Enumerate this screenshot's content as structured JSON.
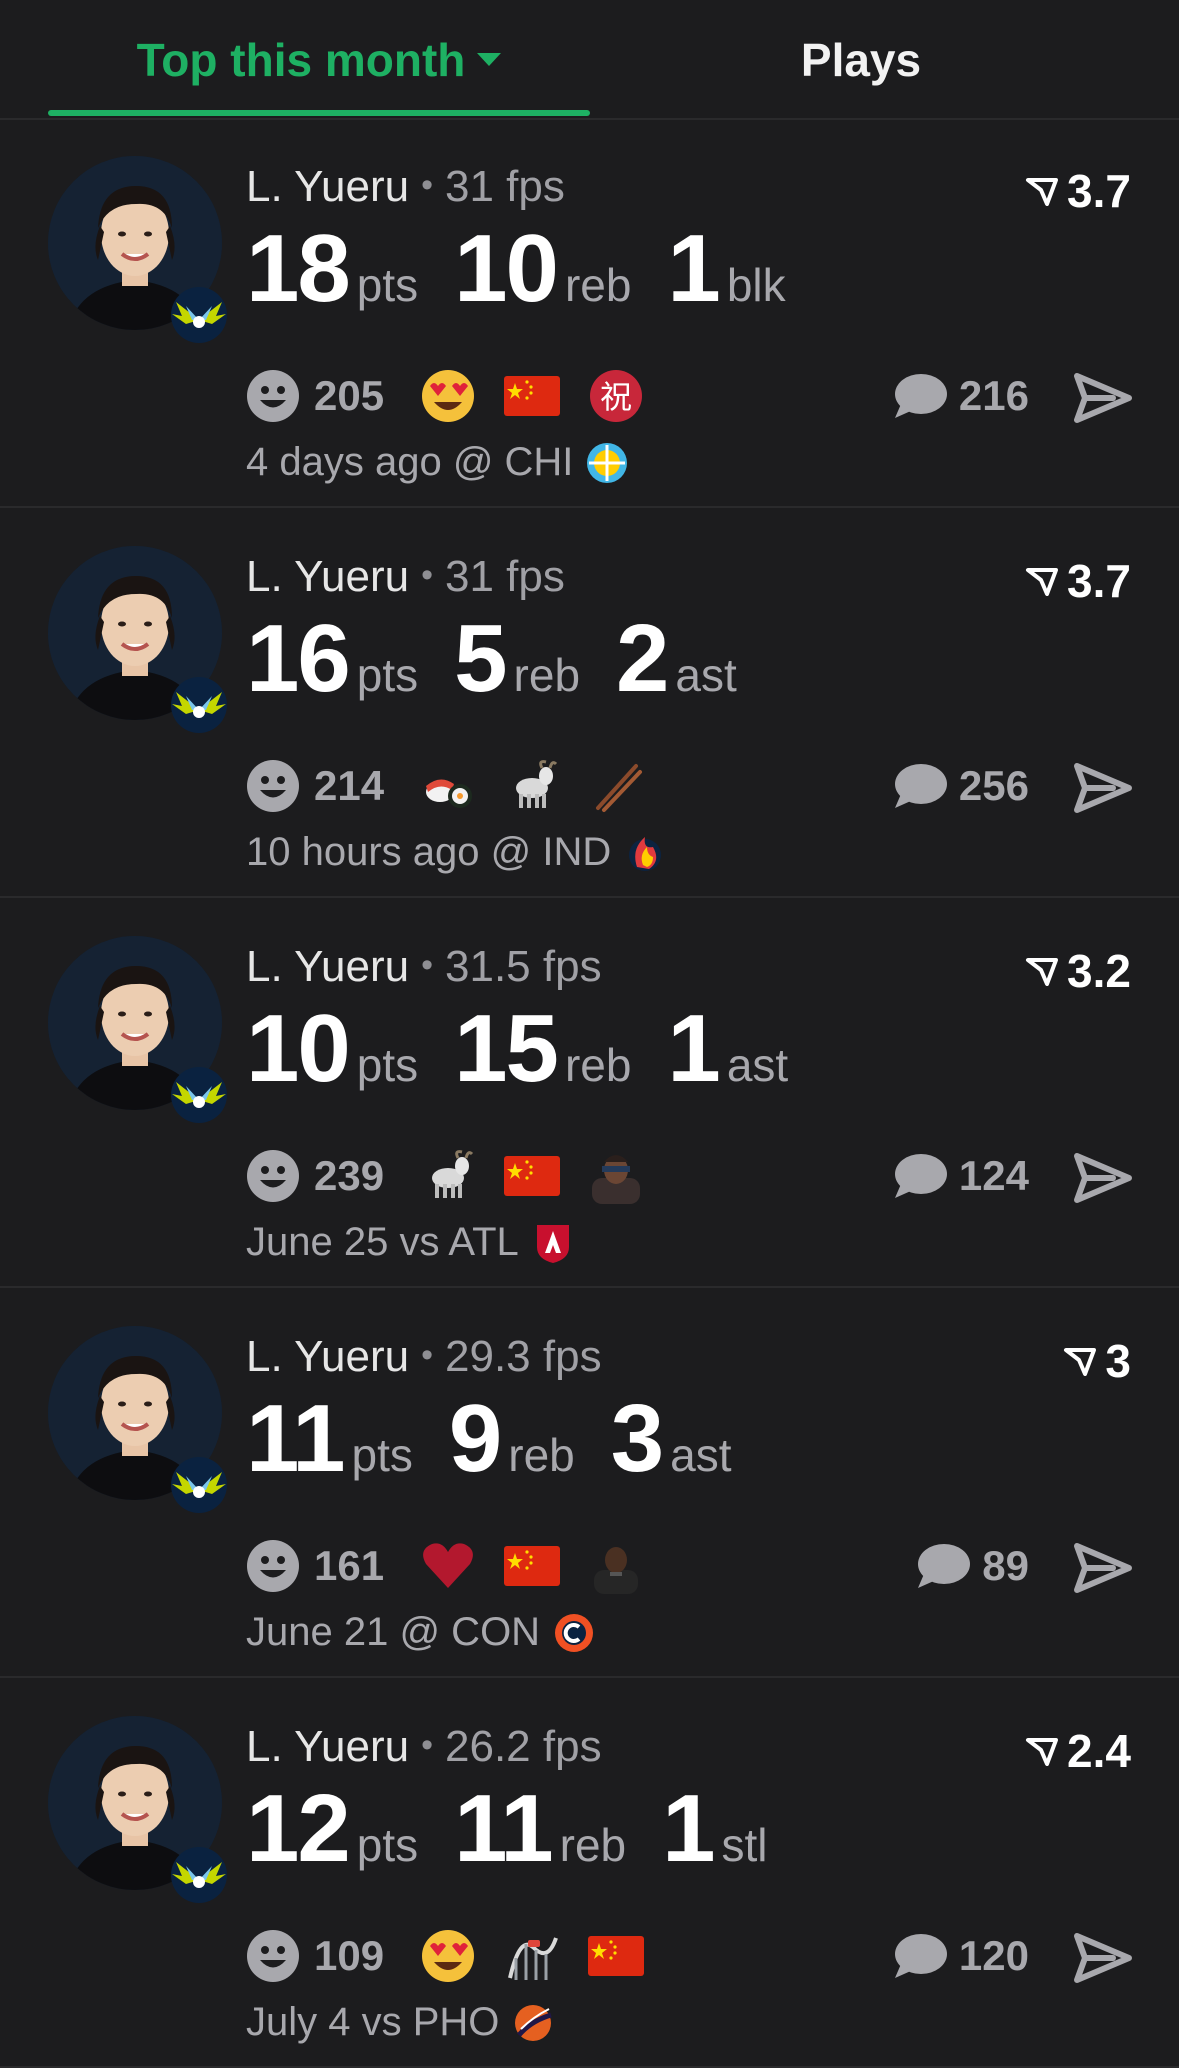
{
  "tabs": {
    "top_label": "Top this month",
    "plays_label": "Plays"
  },
  "colors": {
    "accent": "#1eb063",
    "background": "#1c1c1e",
    "muted": "#a8a8ad"
  },
  "cards": [
    {
      "player": "L. Yueru",
      "fps": "31 fps",
      "rating": "3.7",
      "stats": [
        {
          "num": "18",
          "lbl": "pts"
        },
        {
          "num": "10",
          "lbl": "reb"
        },
        {
          "num": "1",
          "lbl": "blk"
        }
      ],
      "reactions": "205",
      "emojis": [
        "heart-eyes-emoji",
        "china-flag-emoji",
        "congrats-kanji-emoji"
      ],
      "comments": "216",
      "meta": "4 days ago @ CHI",
      "team_logo": "chi-sky-logo"
    },
    {
      "player": "L. Yueru",
      "fps": "31 fps",
      "rating": "3.7",
      "stats": [
        {
          "num": "16",
          "lbl": "pts"
        },
        {
          "num": "5",
          "lbl": "reb"
        },
        {
          "num": "2",
          "lbl": "ast"
        }
      ],
      "reactions": "214",
      "emojis": [
        "sushi-emoji",
        "goat-emoji",
        "chopsticks-emoji"
      ],
      "comments": "256",
      "meta": "10 hours ago @ IND",
      "team_logo": "ind-fever-logo"
    },
    {
      "player": "L. Yueru",
      "fps": "31.5 fps",
      "rating": "3.2",
      "stats": [
        {
          "num": "10",
          "lbl": "pts"
        },
        {
          "num": "15",
          "lbl": "reb"
        },
        {
          "num": "1",
          "lbl": "ast"
        }
      ],
      "reactions": "239",
      "emojis": [
        "goat-emoji",
        "china-flag-emoji",
        "person-blindfold-emoji"
      ],
      "comments": "124",
      "meta": "June 25 vs ATL",
      "team_logo": "atl-dream-logo"
    },
    {
      "player": "L. Yueru",
      "fps": "29.3 fps",
      "rating": "3",
      "stats": [
        {
          "num": "11",
          "lbl": "pts"
        },
        {
          "num": "9",
          "lbl": "reb"
        },
        {
          "num": "3",
          "lbl": "ast"
        }
      ],
      "reactions": "161",
      "emojis": [
        "red-heart-emoji",
        "china-flag-emoji",
        "person-emoji"
      ],
      "comments": "89",
      "meta": "June 21 @ CON",
      "team_logo": "con-sun-logo"
    },
    {
      "player": "L. Yueru",
      "fps": "26.2 fps",
      "rating": "2.4",
      "stats": [
        {
          "num": "12",
          "lbl": "pts"
        },
        {
          "num": "11",
          "lbl": "reb"
        },
        {
          "num": "1",
          "lbl": "stl"
        }
      ],
      "reactions": "109",
      "emojis": [
        "heart-eyes-emoji",
        "roller-coaster-emoji",
        "china-flag-emoji"
      ],
      "comments": "120",
      "meta": "July 4 vs PHO",
      "team_logo": "pho-mercury-logo"
    }
  ]
}
